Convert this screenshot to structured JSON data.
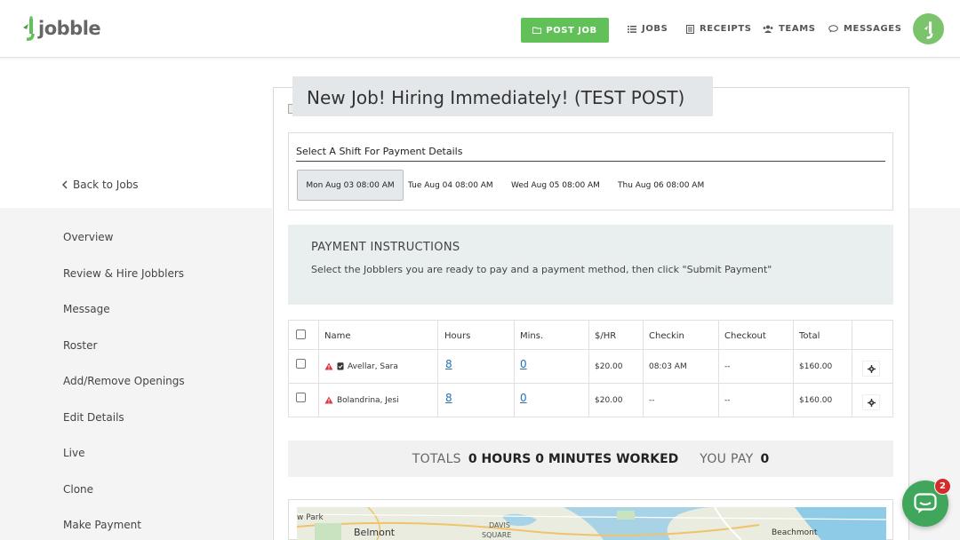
{
  "header": {
    "logo_text": "jobble",
    "post_job_label": "POST JOB",
    "nav": [
      {
        "label": "JOBS",
        "icon": "list-icon"
      },
      {
        "label": "RECEIPTS",
        "icon": "receipt-icon"
      },
      {
        "label": "TEAMS",
        "icon": "people-icon"
      },
      {
        "label": "MESSAGES",
        "icon": "chat-icon"
      }
    ],
    "accent_color": "#62c058"
  },
  "sidebar": {
    "back_label": "Back to Jobs",
    "items": [
      {
        "label": "Overview"
      },
      {
        "label": "Review & Hire Jobblers"
      },
      {
        "label": "Message"
      },
      {
        "label": "Roster"
      },
      {
        "label": "Add/Remove Openings"
      },
      {
        "label": "Edit Details"
      },
      {
        "label": "Live"
      },
      {
        "label": "Clone"
      },
      {
        "label": "Make Payment"
      }
    ]
  },
  "job": {
    "title": "New Job! Hiring Immediately! (TEST POST)"
  },
  "shifts": {
    "heading": "Select A Shift For Payment Details",
    "items": [
      {
        "label": "Mon Aug 03 08:00 AM",
        "selected": true
      },
      {
        "label": "Tue Aug 04 08:00 AM",
        "selected": false
      },
      {
        "label": "Wed Aug 05 08:00 AM",
        "selected": false
      },
      {
        "label": "Thu Aug 06 08:00 AM",
        "selected": false
      }
    ]
  },
  "payment": {
    "heading": "PAYMENT INSTRUCTIONS",
    "text": "Select the Jobblers you are ready to pay and a payment method, then click \"Submit Payment\""
  },
  "table": {
    "columns": [
      "Name",
      "Hours",
      "Mins.",
      "$/HR",
      "Checkin",
      "Checkout",
      "Total"
    ],
    "rows": [
      {
        "name": "Avellar, Sara",
        "hours": "8",
        "mins": "0",
        "rate": "$20.00",
        "checkin": "08:03 AM",
        "checkout": "--",
        "total": "$160.00"
      },
      {
        "name": "Bolandrina, Jesi",
        "hours": "8",
        "mins": "0",
        "rate": "$20.00",
        "checkin": "--",
        "checkout": "--",
        "total": "$160.00"
      }
    ]
  },
  "totals": {
    "label": "TOTALS",
    "worked": "0 HOURS 0 MINUTES WORKED",
    "pay_label": "YOU PAY",
    "pay_value": "0"
  },
  "map": {
    "labels": [
      "w Park",
      "Belmont",
      "DAVIS",
      "SQUARE",
      "Beachmont"
    ]
  },
  "chat": {
    "badge_count": "2"
  }
}
